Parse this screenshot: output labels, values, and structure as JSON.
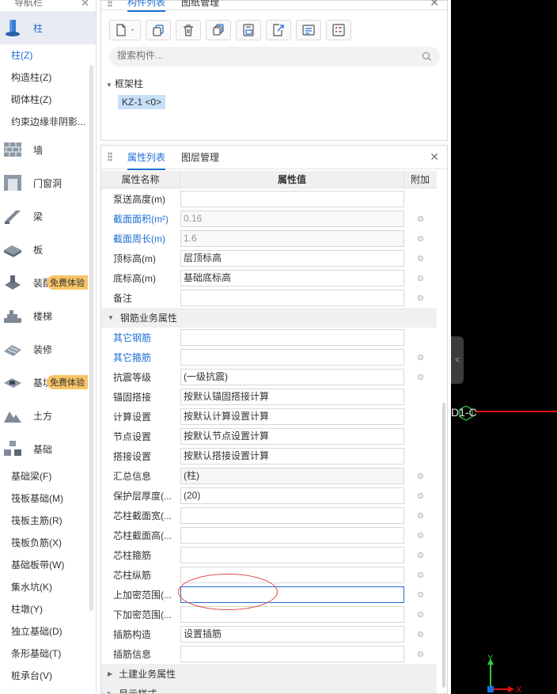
{
  "nav": {
    "title": "导航栏",
    "categories_top": [
      {
        "label": "柱",
        "icon": "column-icon",
        "active": true
      }
    ],
    "sub_column": [
      {
        "label": "柱(Z)",
        "active": true
      },
      {
        "label": "构造柱(Z)"
      },
      {
        "label": "砌体柱(Z)"
      },
      {
        "label": "约束边缘非阴影..."
      }
    ],
    "categories": [
      {
        "label": "墙",
        "icon": "wall-icon"
      },
      {
        "label": "门窗洞",
        "icon": "door-window-icon"
      },
      {
        "label": "梁",
        "icon": "beam-icon"
      },
      {
        "label": "板",
        "icon": "slab-icon"
      },
      {
        "label": "装配式",
        "icon": "prefab-icon",
        "badge": "免费体验"
      },
      {
        "label": "楼梯",
        "icon": "stairs-icon"
      },
      {
        "label": "装修",
        "icon": "decoration-icon"
      },
      {
        "label": "基坑支护",
        "icon": "pit-support-icon",
        "badge": "免费体验"
      },
      {
        "label": "土方",
        "icon": "earthwork-icon"
      },
      {
        "label": "基础",
        "icon": "foundation-icon"
      }
    ],
    "sub_foundation": [
      {
        "label": "基础梁(F)"
      },
      {
        "label": "筏板基础(M)"
      },
      {
        "label": "筏板主筋(R)"
      },
      {
        "label": "筏板负筋(X)"
      },
      {
        "label": "基础板带(W)"
      },
      {
        "label": "集水坑(K)"
      },
      {
        "label": "柱墩(Y)"
      },
      {
        "label": "独立基础(D)"
      },
      {
        "label": "条形基础(T)"
      },
      {
        "label": "桩承台(V)"
      }
    ]
  },
  "component_panel": {
    "tab_active": "构件列表",
    "tab_other": "图纸管理",
    "search_placeholder": "搜索构件...",
    "tree_group": "框架柱",
    "tree_item": "KZ-1 <0>"
  },
  "attr_panel": {
    "tab_active": "属性列表",
    "tab_other": "图层管理",
    "col_name": "属性名称",
    "col_value": "属性值",
    "col_add": "附加",
    "rows_a": [
      {
        "name": "泵送高度(m)",
        "value": "",
        "dot": false
      },
      {
        "name": "截面面积(m²)",
        "value": "0.16",
        "link": true,
        "readonly": true,
        "dot": true
      },
      {
        "name": "截面周长(m)",
        "value": "1.6",
        "link": true,
        "readonly": true,
        "dot": true
      },
      {
        "name": "顶标高(m)",
        "value": "层顶标高",
        "dot": true
      },
      {
        "name": "底标高(m)",
        "value": "基础底标高",
        "dot": true
      },
      {
        "name": "备注",
        "value": "",
        "dot": true
      }
    ],
    "group_rebar": "钢筋业务属性",
    "rows_b": [
      {
        "name": "其它钢筋",
        "value": "",
        "link": true,
        "dot": false
      },
      {
        "name": "其它箍筋",
        "value": "",
        "link": true,
        "dot": true
      },
      {
        "name": "抗震等级",
        "value": "(一级抗震)",
        "dot": true
      },
      {
        "name": "锚固搭接",
        "value": "按默认锚固搭接计算",
        "dot": false
      },
      {
        "name": "计算设置",
        "value": "按默认计算设置计算",
        "dot": false
      },
      {
        "name": "节点设置",
        "value": "按默认节点设置计算",
        "dot": false
      },
      {
        "name": "搭接设置",
        "value": "按默认搭接设置计算",
        "dot": false
      },
      {
        "name": "汇总信息",
        "value": "(柱)",
        "gray": true,
        "dot": true
      },
      {
        "name": "保护层厚度(...",
        "value": "(20)",
        "dot": true
      },
      {
        "name": "芯柱截面宽(...",
        "value": "",
        "dot": true
      },
      {
        "name": "芯柱截面高(...",
        "value": "",
        "dot": true
      },
      {
        "name": "芯柱箍筋",
        "value": "",
        "dot": true
      },
      {
        "name": "芯柱纵筋",
        "value": "",
        "dot": true
      },
      {
        "name": "上加密范围(...",
        "value": "",
        "focus": true,
        "dot": true
      },
      {
        "name": "下加密范围(...",
        "value": "",
        "dot": true
      },
      {
        "name": "插筋构造",
        "value": "设置插筋",
        "dot": true
      },
      {
        "name": "插筋信息",
        "value": "",
        "dot": true
      }
    ],
    "group_civil": "土建业务属性",
    "group_display": "显示样式"
  },
  "canvas": {
    "grid_label": "D1-C",
    "axis_y": "Y",
    "axis_x": "X"
  }
}
